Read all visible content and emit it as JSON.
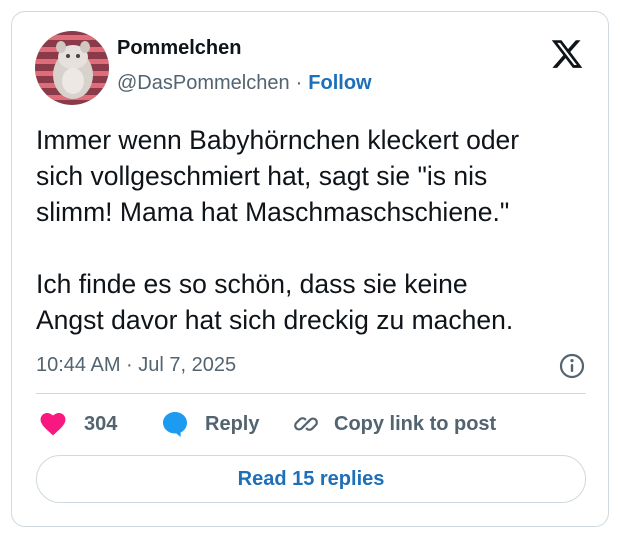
{
  "author": {
    "name": "Pommelchen",
    "handle": "@DasPommelchen",
    "separator": "·",
    "follow_label": "Follow"
  },
  "tweet": {
    "paragraphs": [
      [
        "Immer wenn Babyhörnchen kleckert oder",
        "sich vollgeschmiert hat, sagt sie \"is nis",
        "slimm! Mama hat Maschmaschschiene.\""
      ],
      [
        "Ich finde es so schön, dass sie keine",
        "Angst davor hat sich dreckig zu machen."
      ]
    ],
    "timestamp": "10:44 AM · Jul 7, 2025"
  },
  "actions": {
    "like_count": "304",
    "reply_label": "Reply",
    "copy_label": "Copy link to post"
  },
  "read_replies_label": "Read 15 replies",
  "icons": {
    "logo": "x-logo-icon",
    "like": "heart-icon",
    "reply": "speech-bubble-icon",
    "copy": "link-icon",
    "info": "info-icon"
  },
  "colors": {
    "like": "#f91880",
    "reply": "#1d9bf0",
    "link": "#1d6fb8",
    "muted": "#536471",
    "border": "#cfd9de"
  }
}
